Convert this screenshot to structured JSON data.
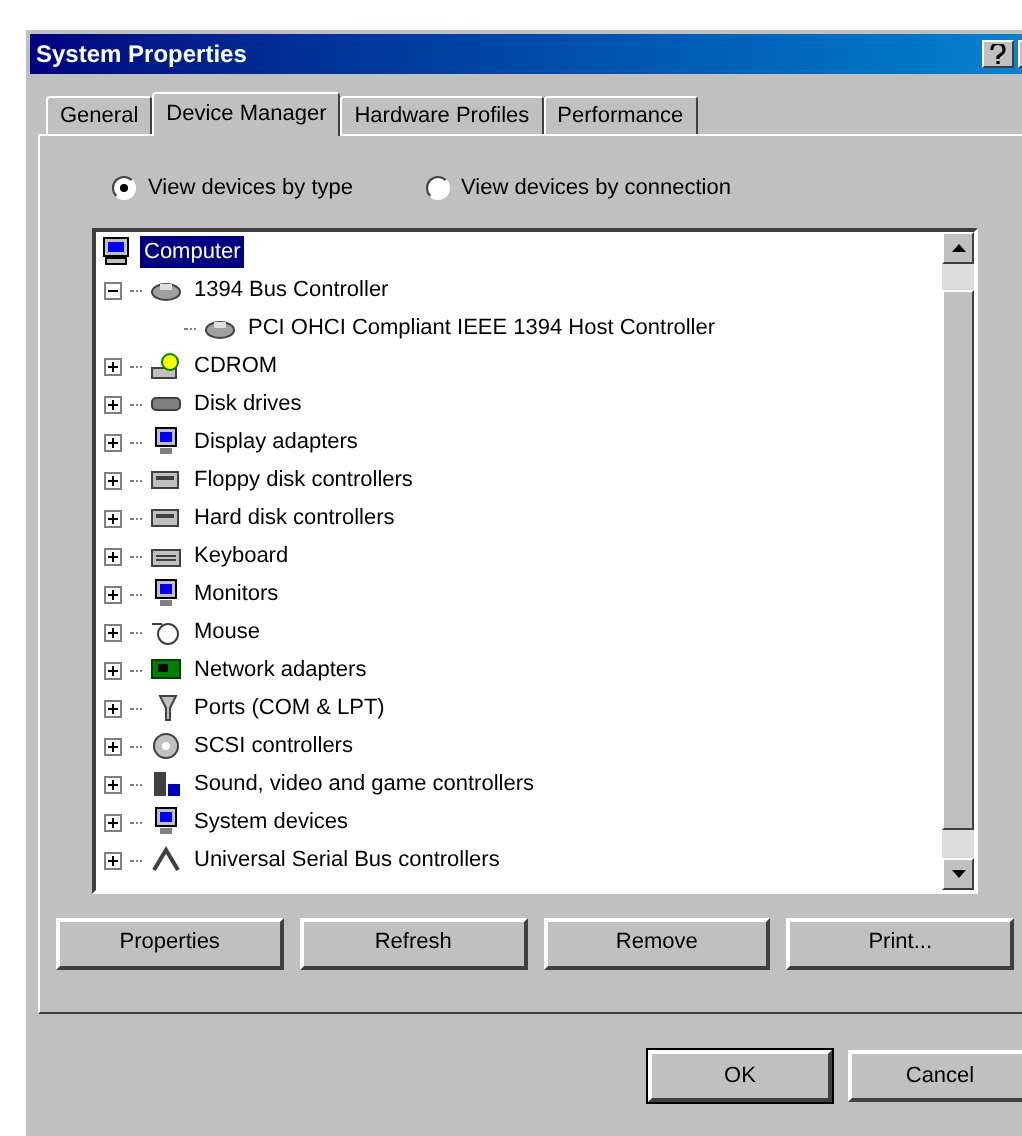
{
  "window": {
    "title": "System Properties"
  },
  "tabs": [
    {
      "label": "General",
      "selected": false
    },
    {
      "label": "Device Manager",
      "selected": true
    },
    {
      "label": "Hardware Profiles",
      "selected": false
    },
    {
      "label": "Performance",
      "selected": false
    }
  ],
  "view_options": [
    {
      "label": "View devices by type",
      "selected": true
    },
    {
      "label": "View devices by connection",
      "selected": false
    }
  ],
  "tree": {
    "label": "Computer",
    "kind": "computer",
    "selected": true,
    "children": [
      {
        "label": "1394 Bus Controller",
        "kind": "controller",
        "selected": false,
        "expanded": true,
        "children": [
          {
            "label": "PCI OHCI Compliant IEEE 1394 Host Controller",
            "kind": "controller",
            "selected": false
          }
        ]
      },
      {
        "label": "CDROM",
        "kind": "cdrom",
        "selected": false,
        "expanded": false
      },
      {
        "label": "Disk drives",
        "kind": "disk",
        "selected": false,
        "expanded": false
      },
      {
        "label": "Display adapters",
        "kind": "monitor",
        "selected": false,
        "expanded": false
      },
      {
        "label": "Floppy disk controllers",
        "kind": "floppy",
        "selected": false,
        "expanded": false
      },
      {
        "label": "Hard disk controllers",
        "kind": "floppy",
        "selected": false,
        "expanded": false
      },
      {
        "label": "Keyboard",
        "kind": "keyboard",
        "selected": false,
        "expanded": false
      },
      {
        "label": "Monitors",
        "kind": "monitor",
        "selected": false,
        "expanded": false
      },
      {
        "label": "Mouse",
        "kind": "mouse",
        "selected": false,
        "expanded": false
      },
      {
        "label": "Network adapters",
        "kind": "network",
        "selected": false,
        "expanded": false
      },
      {
        "label": "Ports (COM & LPT)",
        "kind": "port",
        "selected": false,
        "expanded": false
      },
      {
        "label": "SCSI controllers",
        "kind": "scsi",
        "selected": false,
        "expanded": false
      },
      {
        "label": "Sound, video and game controllers",
        "kind": "sound",
        "selected": false,
        "expanded": false
      },
      {
        "label": "System devices",
        "kind": "monitor",
        "selected": false,
        "expanded": false
      },
      {
        "label": "Universal Serial Bus controllers",
        "kind": "usb",
        "selected": false,
        "expanded": false
      }
    ]
  },
  "action_buttons": [
    "Properties",
    "Refresh",
    "Remove",
    "Print..."
  ],
  "dialog_buttons": [
    "OK",
    "Cancel"
  ]
}
